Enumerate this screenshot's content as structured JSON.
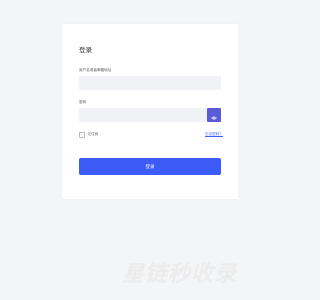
{
  "login": {
    "title": "登录",
    "username_label": "用户名或者邮箱地址",
    "username_value": "",
    "password_label": "密码",
    "password_value": "",
    "remember_label": "记住我",
    "forgot_label": "忘记密码？",
    "submit_label": "登录",
    "password_toggle_icon": "eye-icon"
  },
  "watermark": {
    "text": "星链秒收录"
  },
  "colors": {
    "accent": "#3d5bf6",
    "toggle": "#5b5bd6",
    "link": "#3a5ef5",
    "background": "#f4f5f7"
  }
}
